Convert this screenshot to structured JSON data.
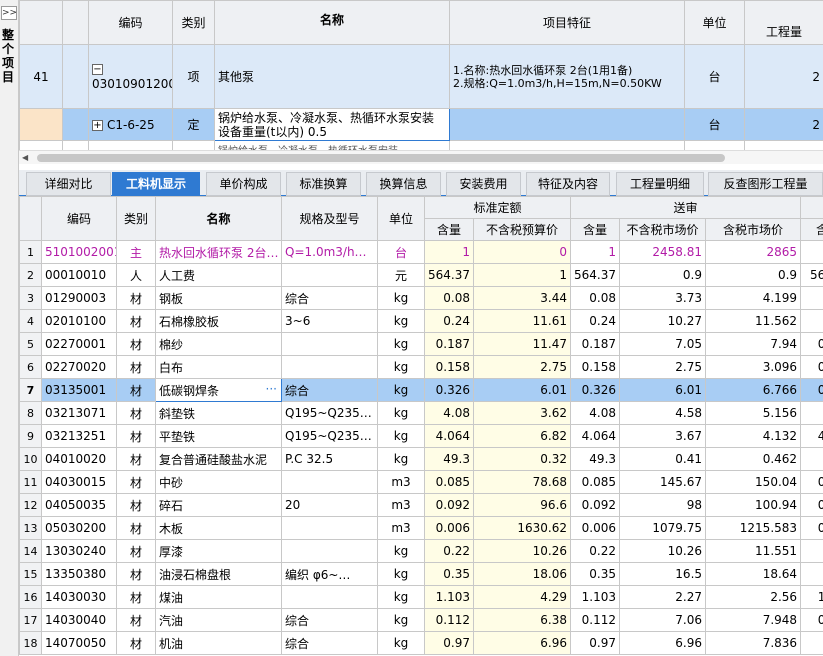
{
  "sidebar": {
    "expand_label": ">>",
    "title": "整个项目"
  },
  "top_grid": {
    "headers": {
      "code": "编码",
      "type": "类别",
      "name": "名称",
      "feature": "项目特征",
      "unit": "单位",
      "qty": "工程量"
    },
    "rows": [
      {
        "no": "41",
        "expander": "−",
        "code": "030109012001",
        "type": "项",
        "name": "其他泵",
        "feature_lines": [
          "1.名称:热水回水循环泵 2台(1用1备)",
          "2.规格:Q=1.0m3/h,H=15m,N=0.50KW"
        ],
        "unit": "台",
        "qty": "2"
      },
      {
        "no": "",
        "expander": "+",
        "code": "C1-6-25",
        "type": "定",
        "name": "锅炉给水泵、冷凝水泵、热循环水泵安装 设备重量(t以内) 0.5",
        "feature_lines": [],
        "unit": "台",
        "qty": "2"
      }
    ],
    "partial_row_text": "锅炉给水泵、冷凝水泵、热循环水泵安装"
  },
  "tabs": [
    "详细对比",
    "工料机显示",
    "单价构成",
    "标准换算",
    "换算信息",
    "安装费用",
    "特征及内容",
    "工程量明细",
    "反查图形工程量"
  ],
  "active_tab": "工料机显示",
  "bottom_grid": {
    "headers": {
      "code": "编码",
      "type": "类别",
      "name": "名称",
      "spec": "规格及型号",
      "unit": "单位",
      "group_std": "标准定额",
      "group_review": "送审",
      "qty": "含量",
      "budget_price": "不含税预算价",
      "market_price_ex": "不含税市场价",
      "market_price_in": "含税市场价"
    },
    "rows": [
      {
        "no": "1",
        "code": "5101002001",
        "type": "主",
        "name": "热水回水循环泵 2台…",
        "spec": "Q=1.0m3/h…",
        "unit": "台",
        "q1": "1",
        "p1": "0",
        "q2": "1",
        "p2": "2458.81",
        "p3": "2865",
        "q3": ""
      },
      {
        "no": "2",
        "code": "00010010",
        "type": "人",
        "name": "人工费",
        "spec": "",
        "unit": "元",
        "q1": "564.37",
        "p1": "1",
        "q2": "564.37",
        "p2": "0.9",
        "p3": "0.9",
        "q3": "564.37"
      },
      {
        "no": "3",
        "code": "01290003",
        "type": "材",
        "name": "钢板",
        "spec": "综合",
        "unit": "kg",
        "q1": "0.08",
        "p1": "3.44",
        "q2": "0.08",
        "p2": "3.73",
        "p3": "4.199",
        "q3": "0.08"
      },
      {
        "no": "4",
        "code": "02010100",
        "type": "材",
        "name": "石棉橡胶板",
        "spec": "3~6",
        "unit": "kg",
        "q1": "0.24",
        "p1": "11.61",
        "q2": "0.24",
        "p2": "10.27",
        "p3": "11.562",
        "q3": "0.24"
      },
      {
        "no": "5",
        "code": "02270001",
        "type": "材",
        "name": "棉纱",
        "spec": "",
        "unit": "kg",
        "q1": "0.187",
        "p1": "11.47",
        "q2": "0.187",
        "p2": "7.05",
        "p3": "7.94",
        "q3": "0.187"
      },
      {
        "no": "6",
        "code": "02270020",
        "type": "材",
        "name": "白布",
        "spec": "",
        "unit": "kg",
        "q1": "0.158",
        "p1": "2.75",
        "q2": "0.158",
        "p2": "2.75",
        "p3": "3.096",
        "q3": "0.158"
      },
      {
        "no": "7",
        "code": "03135001",
        "type": "材",
        "name": "低碳钢焊条",
        "spec": "综合",
        "unit": "kg",
        "q1": "0.326",
        "p1": "6.01",
        "q2": "0.326",
        "p2": "6.01",
        "p3": "6.766",
        "q3": "0.326"
      },
      {
        "no": "8",
        "code": "03213071",
        "type": "材",
        "name": "斜垫铁",
        "spec": "Q195~Q235…",
        "unit": "kg",
        "q1": "4.08",
        "p1": "3.62",
        "q2": "4.08",
        "p2": "4.58",
        "p3": "5.156",
        "q3": "4.08"
      },
      {
        "no": "9",
        "code": "03213251",
        "type": "材",
        "name": "平垫铁",
        "spec": "Q195~Q235…",
        "unit": "kg",
        "q1": "4.064",
        "p1": "6.82",
        "q2": "4.064",
        "p2": "3.67",
        "p3": "4.132",
        "q3": "4.064"
      },
      {
        "no": "10",
        "code": "04010020",
        "type": "材",
        "name": "复合普通硅酸盐水泥",
        "spec": "P.C 32.5",
        "unit": "kg",
        "q1": "49.3",
        "p1": "0.32",
        "q2": "49.3",
        "p2": "0.41",
        "p3": "0.462",
        "q3": "49.3"
      },
      {
        "no": "11",
        "code": "04030015",
        "type": "材",
        "name": "中砂",
        "spec": "",
        "unit": "m3",
        "q1": "0.085",
        "p1": "78.68",
        "q2": "0.085",
        "p2": "145.67",
        "p3": "150.04",
        "q3": "0.085"
      },
      {
        "no": "12",
        "code": "04050035",
        "type": "材",
        "name": "碎石",
        "spec": "20",
        "unit": "m3",
        "q1": "0.092",
        "p1": "96.6",
        "q2": "0.092",
        "p2": "98",
        "p3": "100.94",
        "q3": "0.092"
      },
      {
        "no": "13",
        "code": "05030200",
        "type": "材",
        "name": "木板",
        "spec": "",
        "unit": "m3",
        "q1": "0.006",
        "p1": "1630.62",
        "q2": "0.006",
        "p2": "1079.75",
        "p3": "1215.583",
        "q3": "0.006"
      },
      {
        "no": "14",
        "code": "13030240",
        "type": "材",
        "name": "厚漆",
        "spec": "",
        "unit": "kg",
        "q1": "0.22",
        "p1": "10.26",
        "q2": "0.22",
        "p2": "10.26",
        "p3": "11.551",
        "q3": "0.22"
      },
      {
        "no": "15",
        "code": "13350380",
        "type": "材",
        "name": "油浸石棉盘根",
        "spec": "编织 φ6~…",
        "unit": "kg",
        "q1": "0.35",
        "p1": "18.06",
        "q2": "0.35",
        "p2": "16.5",
        "p3": "18.64",
        "q3": "0.35"
      },
      {
        "no": "16",
        "code": "14030030",
        "type": "材",
        "name": "煤油",
        "spec": "",
        "unit": "kg",
        "q1": "1.103",
        "p1": "4.29",
        "q2": "1.103",
        "p2": "2.27",
        "p3": "2.56",
        "q3": "1.103"
      },
      {
        "no": "17",
        "code": "14030040",
        "type": "材",
        "name": "汽油",
        "spec": "综合",
        "unit": "kg",
        "q1": "0.112",
        "p1": "6.38",
        "q2": "0.112",
        "p2": "7.06",
        "p3": "7.948",
        "q3": "0.112"
      },
      {
        "no": "18",
        "code": "14070050",
        "type": "材",
        "name": "机油",
        "spec": "综合",
        "unit": "kg",
        "q1": "0.97",
        "p1": "6.96",
        "q2": "0.97",
        "p2": "6.96",
        "p3": "7.836",
        "q3": "0.97"
      }
    ],
    "selected_row": 7,
    "edit_button_label": "···"
  },
  "colors": {
    "tab_active": "#2f7ad2",
    "row_selected": "#a8cdf4",
    "main_material_text": "#b21ba7"
  }
}
